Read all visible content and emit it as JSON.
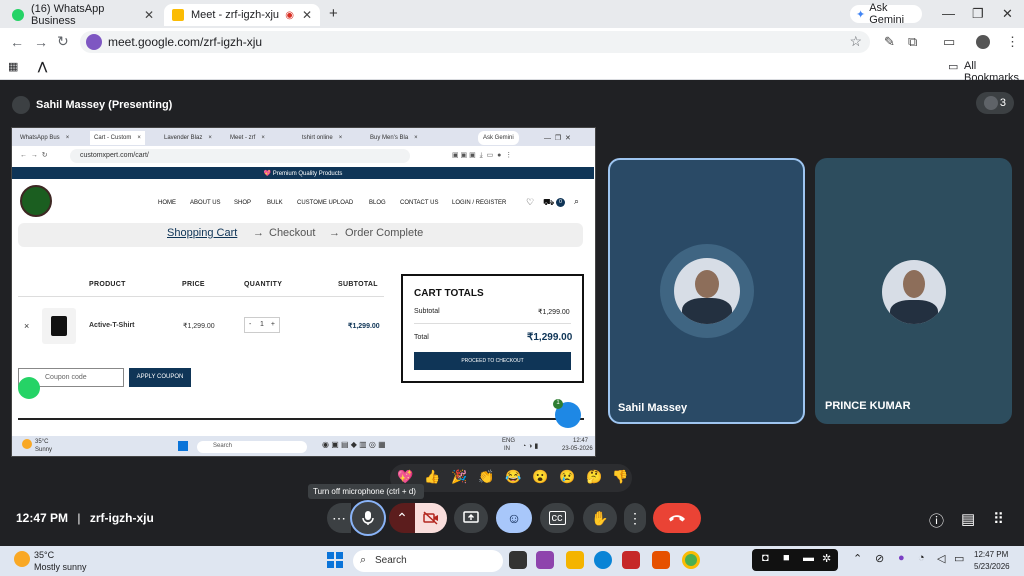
{
  "browser": {
    "tabs": [
      {
        "label": "(16) WhatsApp Business",
        "icon": "whatsapp-icon",
        "active": false
      },
      {
        "label": "Meet - zrf-igzh-xju",
        "icon": "meet-icon",
        "active": true
      }
    ],
    "ask_gemini": "Ask Gemini",
    "url": "meet.google.com/zrf-igzh-xju",
    "bookmarks_label": "All Bookmarks"
  },
  "meet": {
    "presenter": "Sahil Massey (Presenting)",
    "people_count": "3",
    "participants": [
      {
        "name": "Sahil Massey"
      },
      {
        "name": "PRINCE KUMAR"
      }
    ],
    "time": "12:47 PM",
    "separator": "|",
    "meeting_code": "zrf-igzh-xju",
    "mic_tooltip": "Turn off microphone (ctrl + d)",
    "reactions": [
      "💖",
      "👍",
      "🎉",
      "👏",
      "😂",
      "😮",
      "😢",
      "🤔",
      "👎"
    ]
  },
  "shared_screen": {
    "tabs": [
      "WhatsApp Bus",
      "Cart - Custom",
      "Lavender Blaz",
      "Meet - zrf",
      "tshirt online",
      "Buy Men's Bla"
    ],
    "ask_gemini": "Ask Gemini",
    "url": "customxpert.com/cart/",
    "promo": "💖 Premium Quality Products",
    "menu": [
      "HOME",
      "ABOUT US",
      "SHOP",
      "BULK",
      "CUSTOME UPLOAD",
      "BLOG",
      "CONTACT US",
      "LOGIN / REGISTER"
    ],
    "cart_badge": "0",
    "steps": [
      "Shopping Cart",
      "Checkout",
      "Order Complete"
    ],
    "step_arrow": "→",
    "table_headers": [
      "PRODUCT",
      "PRICE",
      "QUANTITY",
      "SUBTOTAL"
    ],
    "item": {
      "remove": "×",
      "name": "Active-T-Shirt",
      "price": "₹1,299.00",
      "qty": "1",
      "minus": "-",
      "plus": "+",
      "subtotal": "₹1,299.00"
    },
    "totals": {
      "title": "CART TOTALS",
      "subtotal_label": "Subtotal",
      "subtotal_value": "₹1,299.00",
      "total_label": "Total",
      "total_value": "₹1,299.00",
      "checkout": "PROCEED TO CHECKOUT"
    },
    "coupon_placeholder": "Coupon code",
    "apply_coupon": "APPLY COUPON",
    "cart_fab_badge": "1",
    "taskbar": {
      "temp": "35°C",
      "cond": "Sunny",
      "search": "Search",
      "lang1": "ENG",
      "lang2": "IN",
      "time": "12:47",
      "date": "23-05-2026"
    }
  },
  "windows_taskbar": {
    "temp": "35°C",
    "weather": "Mostly sunny",
    "search": "Search",
    "time": "12:47 PM",
    "date": "5/23/2026"
  },
  "colors": {
    "meet_bg": "#202124",
    "end_call": "#ea4335",
    "emoji_active": "#a8c7fa",
    "site_navy": "#0f3557"
  }
}
